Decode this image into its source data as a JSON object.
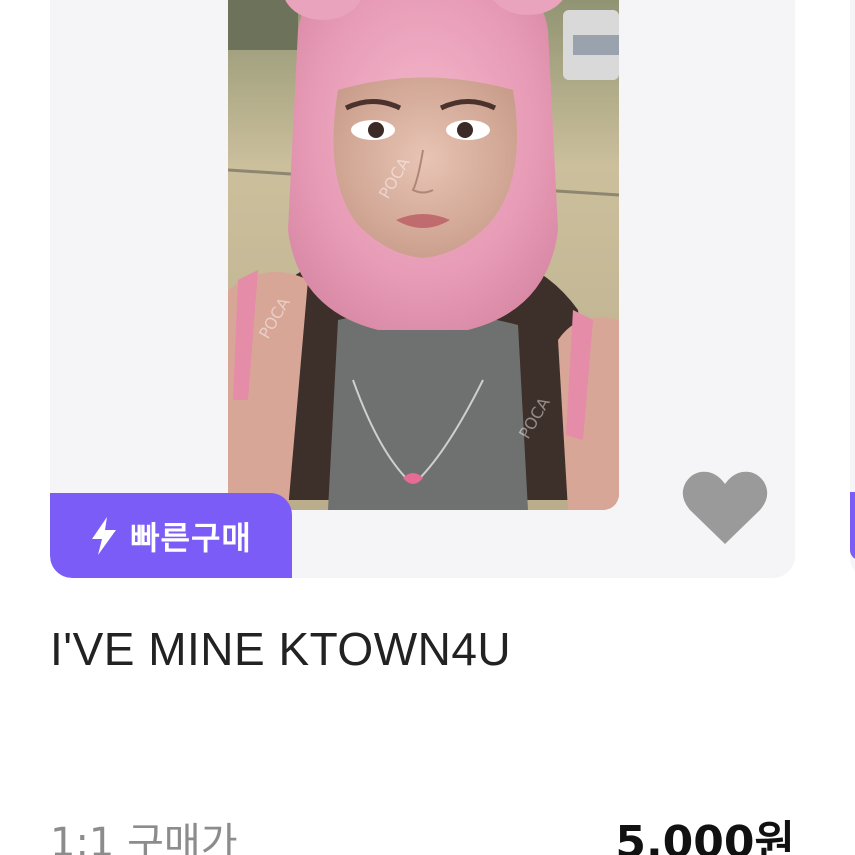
{
  "product": {
    "badge_label": "빠른구매",
    "badge_icon": "lightning-bolt-icon",
    "title": "I'VE MINE KTOWN4U",
    "price_label": "1:1 구매가",
    "price_value": "5,000원",
    "favorite_icon": "heart-icon",
    "photo_watermark": "POCA"
  },
  "colors": {
    "badge_bg": "#7b5cf6",
    "card_bg": "#f5f5f7",
    "heart": "#9a9a9a",
    "title": "#222222",
    "price_label": "#8c8c8c",
    "price_value": "#111111"
  }
}
